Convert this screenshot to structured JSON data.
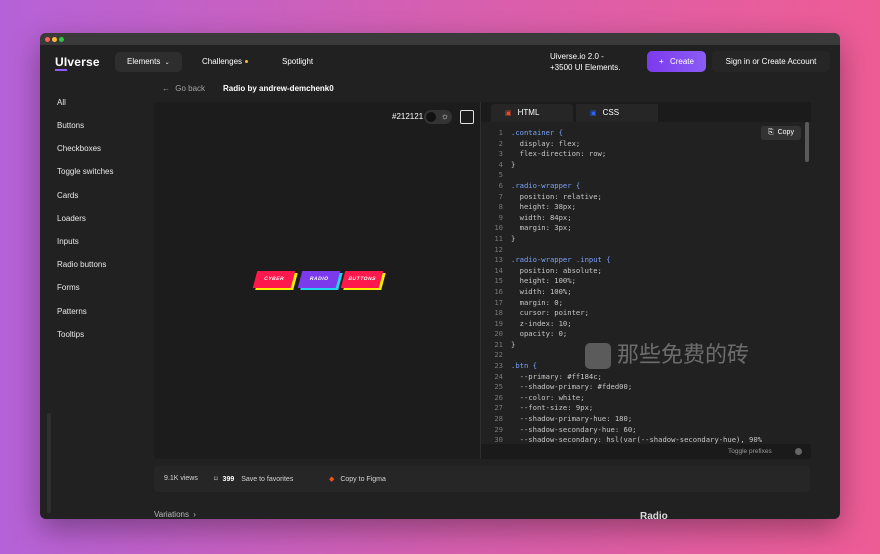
{
  "window": {
    "traffic_lights": [
      "red",
      "yellow",
      "green"
    ]
  },
  "nav": {
    "logo_ui": "UI",
    "logo_rest": "verse",
    "elements_label": "Elements",
    "challenges_label": "Challenges",
    "spotlight_label": "Spotlight",
    "promo_line1": "Uiverse.io 2.0 -",
    "promo_line2": "+3500 UI Elements.",
    "create_label": "Create",
    "signin_label": "Sign in or Create Account",
    "accent_color": "#8b5cf6"
  },
  "sidebar": {
    "items": [
      {
        "label": "All"
      },
      {
        "label": "Buttons"
      },
      {
        "label": "Checkboxes"
      },
      {
        "label": "Toggle switches"
      },
      {
        "label": "Cards"
      },
      {
        "label": "Loaders"
      },
      {
        "label": "Inputs"
      },
      {
        "label": "Radio buttons"
      },
      {
        "label": "Forms"
      },
      {
        "label": "Patterns"
      },
      {
        "label": "Tooltips"
      }
    ]
  },
  "header": {
    "back_label": "Go back",
    "title": "Radio by andrew-demchenk0"
  },
  "preview": {
    "bg_code": "#212121",
    "radio_labels": [
      "CYBER",
      "RADIO",
      "BUTTONS"
    ]
  },
  "editor": {
    "tab_html": "HTML",
    "tab_css": "CSS",
    "copy_label": "Copy",
    "toggle_prefixes": "Toggle prefixes",
    "lines": [
      {
        "n": "1",
        "t": ".container {"
      },
      {
        "n": "2",
        "t": "  display: flex;"
      },
      {
        "n": "3",
        "t": "  flex-direction: row;"
      },
      {
        "n": "4",
        "t": "}"
      },
      {
        "n": "5",
        "t": ""
      },
      {
        "n": "6",
        "t": ".radio-wrapper {"
      },
      {
        "n": "7",
        "t": "  position: relative;"
      },
      {
        "n": "8",
        "t": "  height: 38px;"
      },
      {
        "n": "9",
        "t": "  width: 84px;"
      },
      {
        "n": "10",
        "t": "  margin: 3px;"
      },
      {
        "n": "11",
        "t": "}"
      },
      {
        "n": "12",
        "t": ""
      },
      {
        "n": "13",
        "t": ".radio-wrapper .input {"
      },
      {
        "n": "14",
        "t": "  position: absolute;"
      },
      {
        "n": "15",
        "t": "  height: 100%;"
      },
      {
        "n": "16",
        "t": "  width: 100%;"
      },
      {
        "n": "17",
        "t": "  margin: 0;"
      },
      {
        "n": "18",
        "t": "  cursor: pointer;"
      },
      {
        "n": "19",
        "t": "  z-index: 10;"
      },
      {
        "n": "20",
        "t": "  opacity: 0;"
      },
      {
        "n": "21",
        "t": "}"
      },
      {
        "n": "22",
        "t": ""
      },
      {
        "n": "23",
        "t": ".btn {"
      },
      {
        "n": "24",
        "t": "  --primary: #ff184c;"
      },
      {
        "n": "25",
        "t": "  --shadow-primary: #fded00;"
      },
      {
        "n": "26",
        "t": "  --color: white;"
      },
      {
        "n": "27",
        "t": "  --font-size: 9px;"
      },
      {
        "n": "28",
        "t": "  --shadow-primary-hue: 180;"
      },
      {
        "n": "29",
        "t": "  --shadow-secondary-hue: 60;"
      },
      {
        "n": "30",
        "t": "  --shadow-secondary: hsl(var(--shadow-secondary-hue), 90%"
      }
    ]
  },
  "stats": {
    "views": "9.1K views",
    "favorites_count": "399",
    "favorites_label": "Save to favorites",
    "figma_label": "Copy to Figma"
  },
  "watermark": "那些免费的砖",
  "bottom": {
    "variations": "Variations",
    "right_heading": "Radio"
  }
}
